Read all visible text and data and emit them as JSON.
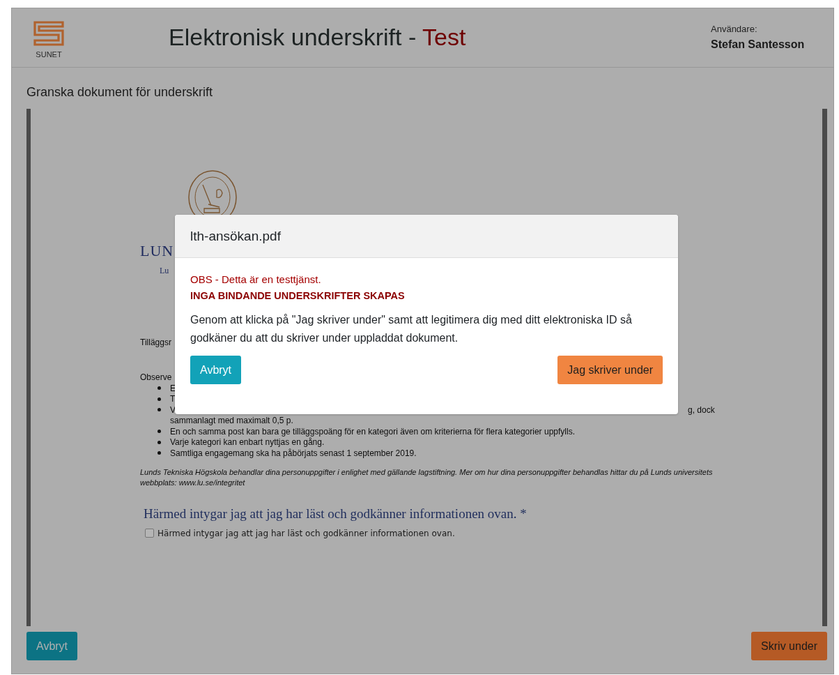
{
  "header": {
    "logo_text": "SUNET",
    "title": "Elektronisk underskrift - ",
    "title_mark": "Test",
    "user_label": "Användare:",
    "user_name": "Stefan Santesson"
  },
  "page_heading": "Granska dokument för underskrift",
  "document": {
    "logo_text": "LUN",
    "logo_subtext": "Lu",
    "intro": "Tilläggsr",
    "observe": "Observe",
    "bullets": [
      {
        "text": "E"
      },
      {
        "text": "T"
      },
      {
        "text": "V",
        "text_right": "g, dock",
        "continuation": "sammanlagt med maximalt 0,5 p."
      },
      {
        "text": "En och samma post kan bara ge tilläggspoäng för en kategori även om kriterierna för flera kategorier uppfylls."
      },
      {
        "text": "Varje kategori kan enbart nyttjas en gång."
      },
      {
        "text": "Samtliga engagemang ska ha påbörjats senast 1 september 2019."
      }
    ],
    "privacy_note": "Lunds Tekniska Högskola behandlar dina personuppgifter i enlighet med gällande lagstiftning. Mer om hur dina personuppgifter behandlas hittar du på Lunds universitets webbplats: www.lu.se/integritet",
    "question": "Härmed intygar jag att jag har läst och godkänner informationen ovan. *",
    "consent": {
      "label": "Härmed intygar jag att jag har läst och godkänner informationen ovan.",
      "checked": false
    }
  },
  "modal": {
    "title": "lth-ansökan.pdf",
    "warning": "OBS - Detta är en testtjänst.",
    "warning_strong": "INGA BINDANDE UNDERSKRIFTER SKAPAS",
    "body": "Genom att klicka på \"Jag skriver under\" samt att legitimera dig med ditt elektroniska ID så godkäner du att du skriver under uppladdat dokument.",
    "cancel": "Avbryt",
    "confirm": "Jag skriver under"
  },
  "actions": {
    "cancel": "Avbryt",
    "sign": "Skriv under"
  }
}
